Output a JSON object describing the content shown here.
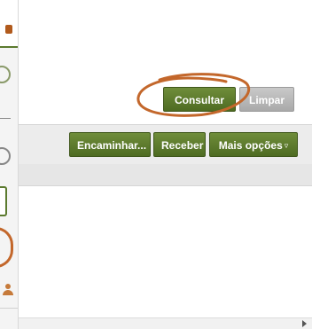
{
  "search_actions": {
    "consultar_label": "Consultar",
    "limpar_label": "Limpar"
  },
  "toolbar": {
    "encaminhar_label": "Encaminhar...",
    "receber_label": "Receber",
    "mais_opcoes_label": "Mais opções",
    "mais_opcoes_arrow": "▿"
  },
  "colors": {
    "button_green": "#5b7a2e",
    "button_disabled": "#b8b8b8",
    "annotation_orange": "#c3672b"
  },
  "icons": {
    "sidebar_user": "user-icon",
    "scroll_right": "chevron-right-icon"
  }
}
